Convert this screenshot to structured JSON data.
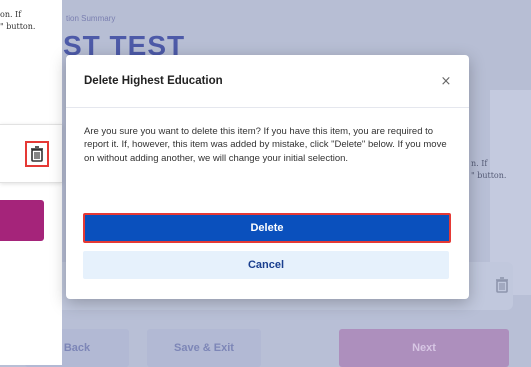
{
  "left_panel": {
    "text_lines": [
      "on. If",
      "\" button."
    ],
    "trash_icon": "trash-icon"
  },
  "background": {
    "summary_label": "tion Summary",
    "title": "ST TEST",
    "right_text_lines": [
      "n. If",
      "\" button."
    ],
    "buttons": {
      "back": "Back",
      "save_exit": "Save & Exit",
      "next": "Next"
    }
  },
  "modal": {
    "title": "Delete Highest Education",
    "close_glyph": "×",
    "body": "Are you sure you want to delete this item? If you have this item, you are required to report it. If, however, this item was added by mistake, click \"Delete\" below. If you move on without adding another, we will change your initial selection.",
    "delete_label": "Delete",
    "cancel_label": "Cancel"
  },
  "colors": {
    "overlay": "#b8bfd6",
    "delete_button": "#0a50bd",
    "cancel_button": "#e6f1fc",
    "highlight_border": "#e53935",
    "left_action_button": "#a5247a"
  }
}
